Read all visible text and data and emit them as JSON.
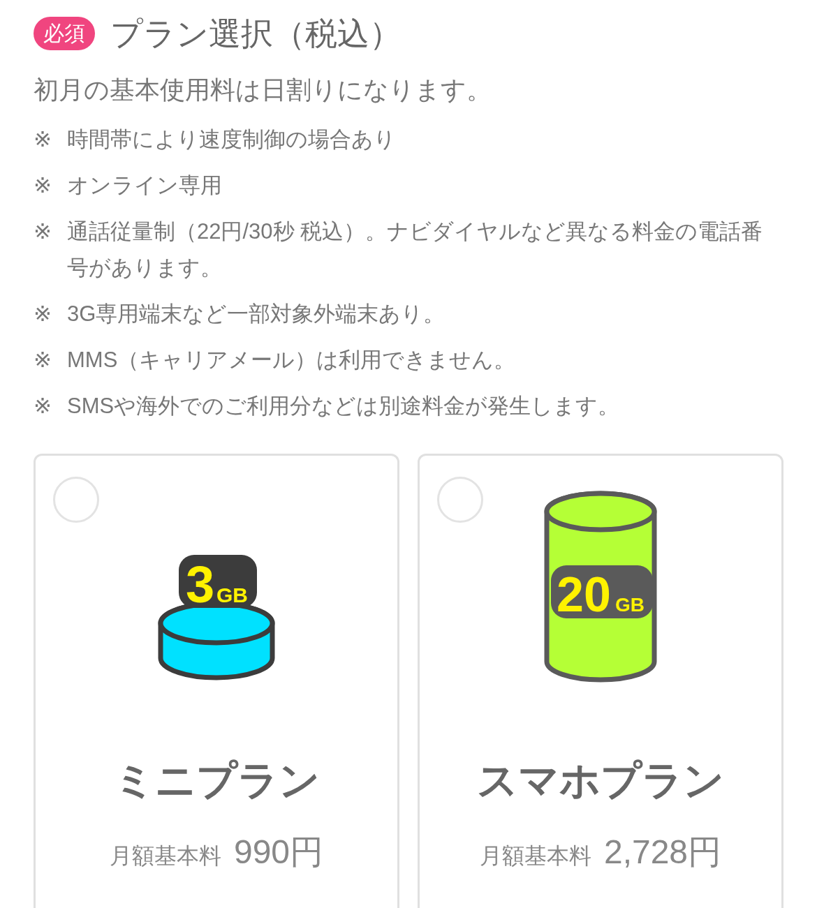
{
  "header": {
    "badge": "必須",
    "title": "プラン選択（税込）"
  },
  "subtitle": "初月の基本使用料は日割りになります。",
  "notes": [
    {
      "mark": "※",
      "text": "時間帯により速度制御の場合あり"
    },
    {
      "mark": "※",
      "text": "オンライン専用"
    },
    {
      "mark": "※",
      "text": "通話従量制（22円/30秒 税込）。ナビダイヤルなど異なる料金の電話番号があります。"
    },
    {
      "mark": "※",
      "text": "3G専用端末など一部対象外端末あり。"
    },
    {
      "mark": "※",
      "text": "MMS（キャリアメール）は利用できません。"
    },
    {
      "mark": "※",
      "text": "SMSや海外でのご利用分などは別途料金が発生します。"
    }
  ],
  "plans": [
    {
      "selected": false,
      "kind": "disc",
      "capacity": "3",
      "unit": "GB",
      "name": "ミニプラン",
      "price_label": "月額基本料",
      "price": "990円"
    },
    {
      "selected": false,
      "kind": "tall",
      "capacity": "20",
      "unit": "GB",
      "name": "スマホプラン",
      "price_label": "月額基本料",
      "price": "2,728円"
    }
  ]
}
